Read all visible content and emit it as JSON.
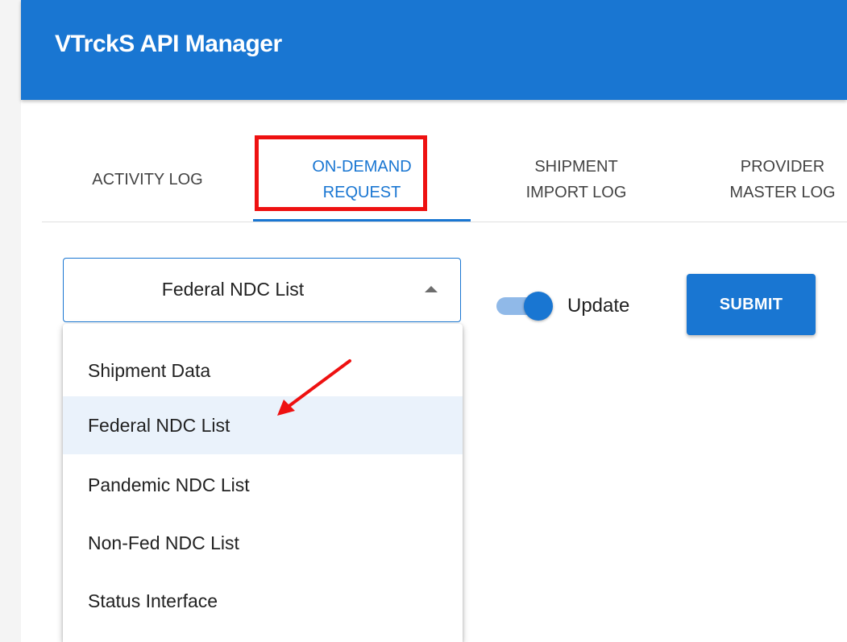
{
  "app": {
    "title": "VTrckS API Manager",
    "brand_color": "#1976d2"
  },
  "tabs": [
    {
      "label": "ACTIVITY LOG",
      "active": false
    },
    {
      "label": "ON-DEMAND\nREQUEST",
      "active": true
    },
    {
      "label": "SHIPMENT\nIMPORT LOG",
      "active": false
    },
    {
      "label": "PROVIDER\nMASTER LOG",
      "active": false
    }
  ],
  "request_form": {
    "select": {
      "value": "Federal NDC List",
      "expanded": true,
      "arrow_icon": "arrow-drop-up-icon"
    },
    "update_toggle": {
      "label": "Update",
      "on": true
    },
    "submit_label": "SUBMIT"
  },
  "dropdown": {
    "options": [
      {
        "label": "Shipment Data",
        "selected": false
      },
      {
        "label": "Federal NDC List",
        "selected": true
      },
      {
        "label": "Pandemic NDC List",
        "selected": false
      },
      {
        "label": "Non-Fed NDC List",
        "selected": false
      },
      {
        "label": "Status Interface",
        "selected": false
      }
    ]
  },
  "annotations": {
    "highlight_color": "#ee1111",
    "highlight_target": "tab-on-demand-request",
    "arrow_target": "dropdown-option-federal-ndc-list"
  }
}
